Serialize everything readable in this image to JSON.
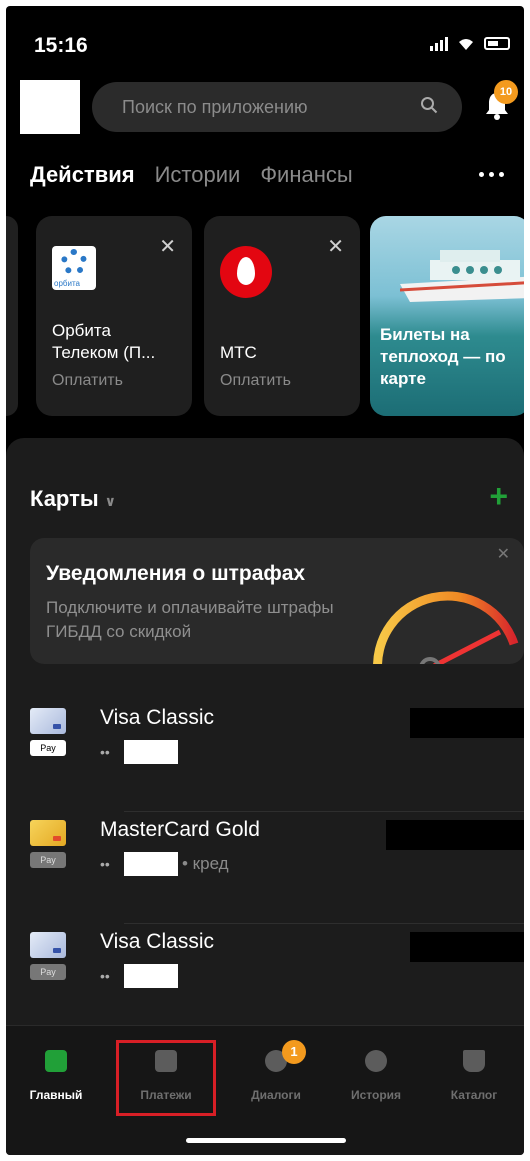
{
  "status": {
    "time": "15:16"
  },
  "header": {
    "search_placeholder": "Поиск по приложению",
    "notifications_count": "10"
  },
  "tabs": [
    {
      "label": "Действия",
      "active": true
    },
    {
      "label": "Истории",
      "active": false
    },
    {
      "label": "Финансы",
      "active": false
    }
  ],
  "actions": [
    {
      "title": "Орбита Телеком (П...",
      "subtitle": "Оплатить",
      "logo_text": "орбита"
    },
    {
      "title": "МТС",
      "subtitle": "Оплатить"
    },
    {
      "title": "Билеты на теплоход — по карте"
    }
  ],
  "cards_section": {
    "title": "Карты",
    "banner": {
      "title": "Уведомления о штрафах",
      "subtitle": "Подключите и оплачивайте штрафы ГИБДД со скидкой"
    },
    "cards": [
      {
        "name": "Visa Classic",
        "dots": "••",
        "tag": "",
        "pay": "Pay"
      },
      {
        "name": "MasterCard Gold",
        "dots": "••",
        "tag": "• кред",
        "pay": "Pay"
      },
      {
        "name": "Visa Classic",
        "dots": "••",
        "tag": "",
        "pay": "Pay"
      }
    ]
  },
  "bottom_nav": [
    {
      "label": "Главный",
      "active": true
    },
    {
      "label": "Платежи",
      "active": false
    },
    {
      "label": "Диалоги",
      "active": false,
      "badge": "1"
    },
    {
      "label": "История",
      "active": false
    },
    {
      "label": "Каталог",
      "active": false
    }
  ],
  "colors": {
    "accent_green": "#21a038",
    "badge_orange": "#f39a1e",
    "highlight_red": "#d81f26"
  }
}
